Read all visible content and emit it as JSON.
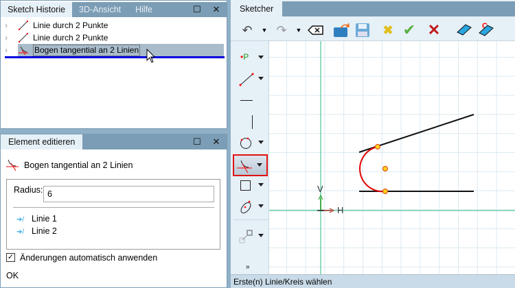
{
  "left_top": {
    "tabs": [
      {
        "label": "Sketch Historie"
      },
      {
        "label": "3D-Ansicht"
      },
      {
        "label": "Hilfe"
      }
    ],
    "history": [
      {
        "label": "Linie durch 2 Punkte",
        "icon": "line-icon"
      },
      {
        "label": "Linie durch 2 Punkte",
        "icon": "line-icon"
      },
      {
        "label": "Bogen tangential an 2 Linien",
        "icon": "tangent-arc-icon",
        "selected": true
      }
    ]
  },
  "editor": {
    "tab": "Element editieren",
    "title": "Bogen tangential an 2 Linien",
    "radius_label": "Radius:",
    "radius_value": "6",
    "references": [
      "Linie 1",
      "Linie 2"
    ],
    "auto_apply_label": "Änderungen automatisch anwenden",
    "auto_apply_checked": true,
    "ok_label": "OK"
  },
  "sketcher": {
    "tab": "Sketcher",
    "status": "Erste(n) Linie/Kreis wählen",
    "axis_h": "H",
    "axis_v": "V"
  },
  "colors": {
    "tabbar": "#7b9db5",
    "accent_red": "#e00000",
    "axis": "#6fcfad",
    "selection": "#a9bccb"
  }
}
